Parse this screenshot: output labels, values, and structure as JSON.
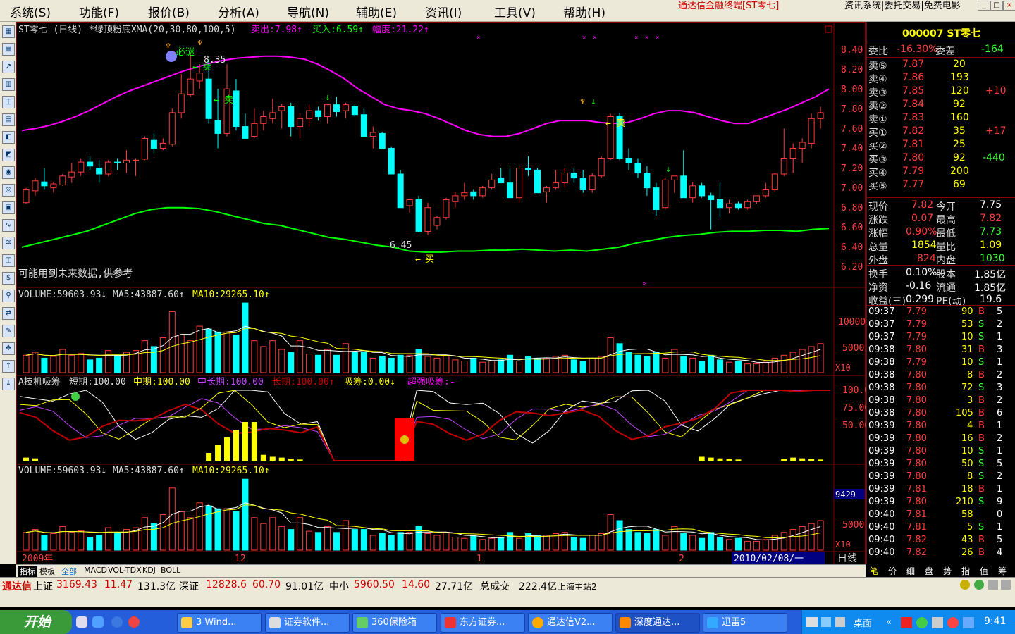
{
  "menu": {
    "items": [
      "系统(S)",
      "功能(F)",
      "报价(B)",
      "分析(A)",
      "导航(N)",
      "辅助(E)",
      "资讯(I)",
      "工具(V)",
      "帮助(H)"
    ],
    "title_text": "通达信金融终端[ST零七]",
    "links": "资讯系统|委托交易|免费电影"
  },
  "window_buttons": [
    "_",
    "□",
    "×"
  ],
  "left_toolbar": [
    "▦",
    "▤",
    "↗",
    "▥",
    "◫",
    "▤",
    "◧",
    "◩",
    "◉",
    "◎",
    "▣",
    "∿",
    "≋",
    "◫",
    "$",
    "⚲",
    "⇄",
    "✎",
    "✥",
    "↑",
    "↓"
  ],
  "chart": {
    "main_header": {
      "name": "ST零七 (日线)",
      "indicator": "*绿顶粉底XMA(20,30,80,100,5)",
      "sell": "卖出:7.98↑",
      "buy": "买入:6.59↑",
      "range": "幅度:21.22↑"
    },
    "note": "可能用到未来数据,供参考",
    "price_axis": [
      "8.40",
      "8.20",
      "8.00",
      "7.80",
      "7.60",
      "7.40",
      "7.20",
      "7.00",
      "6.80",
      "6.60",
      "6.40",
      "6.20"
    ],
    "annotations": {
      "high_price": "8.35",
      "low_price": "6.45",
      "bimi": "必谜",
      "sell": "卖",
      "buy": "买"
    },
    "volume_header": {
      "volume": "VOLUME:59603.93↓",
      "ma5": "MA5:43887.60↑",
      "ma10": "MA10:29265.10↑"
    },
    "volume_axis": [
      "10000",
      "5000"
    ],
    "x10": "X10",
    "ind_header": {
      "name": "A技机吸筹",
      "short": "短期:100.00",
      "mid": "中期:100.00",
      "midlong": "中长期:100.00",
      "long": "长期:100.00↑",
      "absorb": "吸筹:0.00↓",
      "strong": "超强吸筹:-"
    },
    "ind_axis": [
      "100.0",
      "75.00",
      "50.00"
    ],
    "volume2_header": {
      "volume": "VOLUME:59603.93↓",
      "ma5": "MA5:43887.60↑",
      "ma10": "MA10:29265.10↑"
    },
    "volume2_axis": [
      "9429",
      "5000"
    ],
    "date_axis": [
      "2009年",
      "12",
      "1",
      "2"
    ],
    "cursor_date": "2010/02/08/一",
    "period": "日线"
  },
  "chart_data": {
    "type": "candlestick",
    "symbol": "ST零七",
    "period": "日线",
    "ylim": [
      6.2,
      8.4
    ],
    "ohlc": [
      [
        6.85,
        7.0,
        6.84,
        6.98
      ],
      [
        6.97,
        7.1,
        6.92,
        7.07
      ],
      [
        7.06,
        7.2,
        6.98,
        7.02
      ],
      [
        7.0,
        7.06,
        6.95,
        7.04
      ],
      [
        7.03,
        7.14,
        7.02,
        7.12
      ],
      [
        7.11,
        7.25,
        7.05,
        7.16
      ],
      [
        7.16,
        7.3,
        7.12,
        7.26
      ],
      [
        7.26,
        7.32,
        7.18,
        7.22
      ],
      [
        7.2,
        7.28,
        7.05,
        7.14
      ],
      [
        7.14,
        7.28,
        7.12,
        7.26
      ],
      [
        7.26,
        7.3,
        7.18,
        7.25
      ],
      [
        7.25,
        7.38,
        7.15,
        7.28
      ],
      [
        7.28,
        7.3,
        7.12,
        7.28
      ],
      [
        7.29,
        7.52,
        7.28,
        7.5
      ],
      [
        7.48,
        7.55,
        7.35,
        7.4
      ],
      [
        7.4,
        7.5,
        7.38,
        7.45
      ],
      [
        7.44,
        7.8,
        7.42,
        7.76
      ],
      [
        7.76,
        8.15,
        7.7,
        7.95
      ],
      [
        7.94,
        8.35,
        7.92,
        8.1
      ],
      [
        8.08,
        8.25,
        8.0,
        8.16
      ],
      [
        8.1,
        8.3,
        7.65,
        7.7
      ],
      [
        7.68,
        8.0,
        7.4,
        7.55
      ],
      [
        7.55,
        8.25,
        7.52,
        8.0
      ],
      [
        7.98,
        8.1,
        7.58,
        7.62
      ],
      [
        7.62,
        7.75,
        7.5,
        7.5
      ],
      [
        7.52,
        7.8,
        7.5,
        7.65
      ],
      [
        7.65,
        7.78,
        7.58,
        7.72
      ],
      [
        7.7,
        7.9,
        7.65,
        7.76
      ],
      [
        7.78,
        7.85,
        7.6,
        7.82
      ],
      [
        7.82,
        7.86,
        7.52,
        7.62
      ],
      [
        7.62,
        7.75,
        7.5,
        7.7
      ],
      [
        7.7,
        7.84,
        7.62,
        7.78
      ],
      [
        7.78,
        7.82,
        7.68,
        7.72
      ],
      [
        7.72,
        7.85,
        7.65,
        7.84
      ],
      [
        7.84,
        7.92,
        7.72,
        7.77
      ],
      [
        7.78,
        7.86,
        7.7,
        7.84
      ],
      [
        7.82,
        7.85,
        7.72,
        7.74
      ],
      [
        7.74,
        7.8,
        7.52,
        7.52
      ],
      [
        7.52,
        7.62,
        7.4,
        7.56
      ],
      [
        7.55,
        7.56,
        7.4,
        7.4
      ],
      [
        7.4,
        7.42,
        7.14,
        7.14
      ],
      [
        7.14,
        7.18,
        6.8,
        6.8
      ],
      [
        6.82,
        6.88,
        6.75,
        6.88
      ],
      [
        6.88,
        6.92,
        6.55,
        6.56
      ],
      [
        6.56,
        6.85,
        6.52,
        6.8
      ],
      [
        6.62,
        6.72,
        6.58,
        6.7
      ],
      [
        6.7,
        6.9,
        6.68,
        6.88
      ],
      [
        6.86,
        6.96,
        6.8,
        6.92
      ],
      [
        6.92,
        7.05,
        6.88,
        6.95
      ],
      [
        6.96,
        6.98,
        6.88,
        6.92
      ],
      [
        6.92,
        7.02,
        6.9,
        7.0
      ],
      [
        7.0,
        7.14,
        6.98,
        7.08
      ],
      [
        7.1,
        7.2,
        7.05,
        7.05
      ],
      [
        7.05,
        7.2,
        6.98,
        6.9
      ],
      [
        6.9,
        7.22,
        6.85,
        7.2
      ],
      [
        7.2,
        7.32,
        7.12,
        7.18
      ],
      [
        7.18,
        7.2,
        7.0,
        6.95
      ],
      [
        6.96,
        7.02,
        6.85,
        7.0
      ],
      [
        7.0,
        7.18,
        6.98,
        7.05
      ],
      [
        7.05,
        7.2,
        7.0,
        7.15
      ],
      [
        7.15,
        7.2,
        7.05,
        7.1
      ],
      [
        7.1,
        7.18,
        6.95,
        6.98
      ],
      [
        6.98,
        7.15,
        6.95,
        7.12
      ],
      [
        7.12,
        7.32,
        7.1,
        7.3
      ],
      [
        7.3,
        7.75,
        7.28,
        7.72
      ],
      [
        7.72,
        7.76,
        7.28,
        7.3
      ],
      [
        7.3,
        7.4,
        7.18,
        7.25
      ],
      [
        7.25,
        7.3,
        7.1,
        7.15
      ],
      [
        7.15,
        7.22,
        6.92,
        7.0
      ],
      [
        7.0,
        7.05,
        6.72,
        6.78
      ],
      [
        6.8,
        7.1,
        6.78,
        7.08
      ],
      [
        7.08,
        7.12,
        6.95,
        7.12
      ],
      [
        7.12,
        7.38,
        6.9,
        6.9
      ],
      [
        6.9,
        7.06,
        6.85,
        7.02
      ],
      [
        7.02,
        7.05,
        6.9,
        6.92
      ],
      [
        6.92,
        6.95,
        6.58,
        6.88
      ],
      [
        6.88,
        7.05,
        6.7,
        6.8
      ],
      [
        6.8,
        6.88,
        6.74,
        6.84
      ],
      [
        6.84,
        6.86,
        6.78,
        6.8
      ],
      [
        6.8,
        6.88,
        6.78,
        6.86
      ],
      [
        6.86,
        6.92,
        6.84,
        6.92
      ],
      [
        6.92,
        7.05,
        6.9,
        6.98
      ],
      [
        6.98,
        7.15,
        6.96,
        7.14
      ],
      [
        7.14,
        7.6,
        7.12,
        7.3
      ],
      [
        7.3,
        7.45,
        7.15,
        7.4
      ],
      [
        7.4,
        7.5,
        7.25,
        7.46
      ],
      [
        7.45,
        7.75,
        7.4,
        7.7
      ],
      [
        7.7,
        7.82,
        7.6,
        7.76
      ]
    ],
    "ma_top": [
      7.58,
      7.6,
      7.63,
      7.67,
      7.72,
      7.78,
      7.85,
      7.92,
      7.98,
      8.03,
      8.08,
      8.13,
      8.18,
      8.22,
      8.26,
      8.29,
      8.31,
      8.32,
      8.33,
      8.33,
      8.32,
      8.3,
      8.25,
      8.18,
      8.1,
      8.0,
      7.92,
      7.84,
      7.8,
      7.78,
      7.75,
      7.7,
      7.64,
      7.58,
      7.54,
      7.52,
      7.52,
      7.55,
      7.6,
      7.65,
      7.68,
      7.68,
      7.68,
      7.66,
      7.65,
      7.66,
      7.7,
      7.75,
      7.78,
      7.78,
      7.76,
      7.72,
      7.68,
      7.65,
      7.65,
      7.7,
      7.75,
      7.8,
      7.86,
      7.92,
      8.0
    ],
    "ma_bottom": [
      6.4,
      6.44,
      6.48,
      6.52,
      6.56,
      6.62,
      6.68,
      6.74,
      6.78,
      6.8,
      6.8,
      6.79,
      6.76,
      6.72,
      6.68,
      6.64,
      6.62,
      6.58,
      6.54,
      6.5,
      6.48,
      6.45,
      6.42,
      6.4,
      6.36,
      6.35,
      6.35,
      6.36,
      6.36,
      6.37,
      6.37,
      6.38,
      6.37,
      6.36,
      6.37,
      6.36,
      6.38,
      6.4,
      6.44,
      6.47,
      6.5,
      6.52,
      6.53,
      6.55,
      6.56,
      6.56,
      6.57,
      6.57,
      6.56,
      6.58,
      6.59
    ],
    "volume": [
      30,
      35,
      25,
      28,
      40,
      30,
      33,
      22,
      25,
      38,
      30,
      35,
      38,
      55,
      45,
      60,
      105,
      65,
      55,
      80,
      75,
      70,
      70,
      65,
      120,
      55,
      45,
      55,
      40,
      35,
      55,
      32,
      30,
      40,
      30,
      50,
      35,
      35,
      25,
      28,
      25,
      30,
      30,
      40,
      28,
      25,
      30,
      22,
      20,
      25,
      18,
      20,
      22,
      30,
      20,
      28,
      25,
      25,
      28,
      30,
      22,
      20,
      25,
      28,
      60,
      50,
      35,
      30,
      28,
      35,
      25,
      40,
      28,
      25,
      20,
      30,
      22,
      18,
      20,
      15,
      15,
      18,
      25,
      30,
      35,
      40,
      45,
      50
    ],
    "volume_ylim": [
      0,
      125
    ]
  },
  "quote": {
    "code": "000007 ST零七",
    "weibi": {
      "label": "委比",
      "value": "-16.30%"
    },
    "weicha": {
      "label": "委差",
      "value": "-164"
    },
    "sells": [
      {
        "label": "卖⑤",
        "price": "7.87",
        "vol": "20",
        "chg": ""
      },
      {
        "label": "卖④",
        "price": "7.86",
        "vol": "193",
        "chg": ""
      },
      {
        "label": "卖③",
        "price": "7.85",
        "vol": "120",
        "chg": "+10"
      },
      {
        "label": "卖②",
        "price": "7.84",
        "vol": "92",
        "chg": ""
      },
      {
        "label": "卖①",
        "price": "7.83",
        "vol": "160",
        "chg": ""
      }
    ],
    "buys": [
      {
        "label": "买①",
        "price": "7.82",
        "vol": "35",
        "chg": "+17"
      },
      {
        "label": "买②",
        "price": "7.81",
        "vol": "25",
        "chg": ""
      },
      {
        "label": "买③",
        "price": "7.80",
        "vol": "92",
        "chg": "-440"
      },
      {
        "label": "买④",
        "price": "7.79",
        "vol": "200",
        "chg": ""
      },
      {
        "label": "买⑤",
        "price": "7.77",
        "vol": "69",
        "chg": ""
      }
    ],
    "stats": [
      {
        "l1": "现价",
        "v1": "7.82",
        "c1": "red",
        "l2": "今开",
        "v2": "7.75",
        "c2": "wht"
      },
      {
        "l1": "涨跌",
        "v1": "0.07",
        "c1": "red",
        "l2": "最高",
        "v2": "7.82",
        "c2": "red"
      },
      {
        "l1": "涨幅",
        "v1": "0.90%",
        "c1": "red",
        "l2": "最低",
        "v2": "7.73",
        "c2": "grn"
      },
      {
        "l1": "总量",
        "v1": "1854",
        "c1": "yel",
        "l2": "量比",
        "v2": "1.09",
        "c2": "yel"
      },
      {
        "l1": "外盘",
        "v1": "824",
        "c1": "red",
        "l2": "内盘",
        "v2": "1030",
        "c2": "grn"
      }
    ],
    "stats2": [
      {
        "l1": "换手",
        "v1": "0.10%",
        "l2": "股本",
        "v2": "1.85亿"
      },
      {
        "l1": "净资",
        "v1": "-0.16",
        "l2": "流通",
        "v2": "1.85亿"
      },
      {
        "l1": "收益(三)",
        "v1": "0.299",
        "l2": "PE(动)",
        "v2": "19.6"
      }
    ],
    "ticks": [
      {
        "time": "09:37",
        "price": "7.79",
        "vol": "90",
        "bs": "B",
        "n": "5"
      },
      {
        "time": "09:37",
        "price": "7.79",
        "vol": "53",
        "bs": "S",
        "n": "2"
      },
      {
        "time": "09:37",
        "price": "7.79",
        "vol": "10",
        "bs": "S",
        "n": "1"
      },
      {
        "time": "09:38",
        "price": "7.80",
        "vol": "31",
        "bs": "B",
        "n": "3"
      },
      {
        "time": "09:38",
        "price": "7.79",
        "vol": "10",
        "bs": "S",
        "n": "1"
      },
      {
        "time": "09:38",
        "price": "7.80",
        "vol": "8",
        "bs": "B",
        "n": "2"
      },
      {
        "time": "09:38",
        "price": "7.80",
        "vol": "72",
        "bs": "S",
        "n": "3"
      },
      {
        "time": "09:38",
        "price": "7.80",
        "vol": "3",
        "bs": "B",
        "n": "2"
      },
      {
        "time": "09:38",
        "price": "7.80",
        "vol": "105",
        "bs": "B",
        "n": "6"
      },
      {
        "time": "09:39",
        "price": "7.80",
        "vol": "4",
        "bs": "B",
        "n": "1"
      },
      {
        "time": "09:39",
        "price": "7.80",
        "vol": "16",
        "bs": "B",
        "n": "2"
      },
      {
        "time": "09:39",
        "price": "7.80",
        "vol": "10",
        "bs": "S",
        "n": "1"
      },
      {
        "time": "09:39",
        "price": "7.80",
        "vol": "50",
        "bs": "S",
        "n": "5"
      },
      {
        "time": "09:39",
        "price": "7.80",
        "vol": "8",
        "bs": "S",
        "n": "2"
      },
      {
        "time": "09:39",
        "price": "7.81",
        "vol": "18",
        "bs": "B",
        "n": "1"
      },
      {
        "time": "09:39",
        "price": "7.80",
        "vol": "210",
        "bs": "S",
        "n": "9"
      },
      {
        "time": "09:40",
        "price": "7.81",
        "vol": "58",
        "bs": "",
        "n": "0"
      },
      {
        "time": "09:40",
        "price": "7.81",
        "vol": "5",
        "bs": "S",
        "n": "1"
      },
      {
        "time": "09:40",
        "price": "7.82",
        "vol": "43",
        "bs": "B",
        "n": "5"
      },
      {
        "time": "09:40",
        "price": "7.82",
        "vol": "26",
        "bs": "B",
        "n": "4"
      }
    ]
  },
  "bottom_tabs": [
    "指标",
    "模板",
    "全部",
    "MACD",
    "VOL-TDX",
    "KDJ",
    "BOLL"
  ],
  "right_tabs": [
    "笔",
    "价",
    "细",
    "盘",
    "势",
    "指",
    "值",
    "筹"
  ],
  "status": {
    "brand": "通达信",
    "sh_label": "上证",
    "sh_val": "3169.43",
    "sh_chg": "11.47",
    "sh_amt": "131.3亿",
    "sz_label": "深证",
    "sz_val": "12828.6",
    "sz_chg": "60.70",
    "sz_amt": "91.01亿",
    "zx_label": "中小",
    "zx_val": "5960.50",
    "zx_chg": "14.60",
    "zx_amt": "27.71亿",
    "total_label": "总成交",
    "total": "222.4亿",
    "station": "上海主站2"
  },
  "taskbar": {
    "start": "开始",
    "items": [
      "3 Wind...",
      "证券软件...",
      "360保险箱",
      "东方证券...",
      "通达信V2...",
      "深度通达...",
      "迅雷5"
    ],
    "tray_label": "桌面",
    "clock": "9:41"
  }
}
